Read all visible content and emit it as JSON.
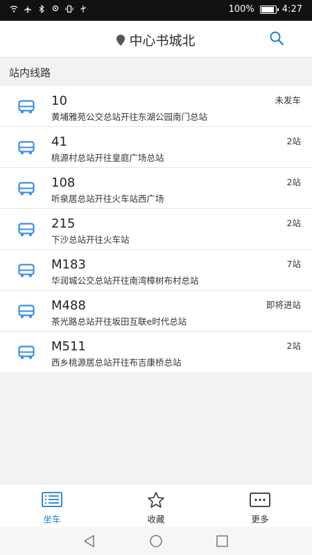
{
  "status": {
    "battery": "100%",
    "time": "4:27"
  },
  "header": {
    "title": "中心书城北"
  },
  "section_title": "站内线路",
  "routes": [
    {
      "line": "10",
      "route": "黄埔雅苑公交总站开往东湖公园南门总站",
      "status": "未发车"
    },
    {
      "line": "41",
      "route": "桃源村总站开往皇庭广场总站",
      "status": "2站"
    },
    {
      "line": "108",
      "route": "听泉居总站开往火车站西广场",
      "status": "2站"
    },
    {
      "line": "215",
      "route": "下沙总站开往火车站",
      "status": "2站"
    },
    {
      "line": "M183",
      "route": "华润城公交总站开往南湾樟树布村总站",
      "status": "7站"
    },
    {
      "line": "M488",
      "route": "茶光路总站开往坂田互联e时代总站",
      "status": "即将进站"
    },
    {
      "line": "M511",
      "route": "西乡桃源居总站开往布吉康桥总站",
      "status": "2站"
    }
  ],
  "tabs": [
    {
      "label": "坐车",
      "icon": "list-icon",
      "active": true
    },
    {
      "label": "收藏",
      "icon": "star-icon",
      "active": false
    },
    {
      "label": "更多",
      "icon": "more-icon",
      "active": false
    }
  ],
  "colors": {
    "accent": "#1a7fd4",
    "icon": "#3a8ee6"
  }
}
